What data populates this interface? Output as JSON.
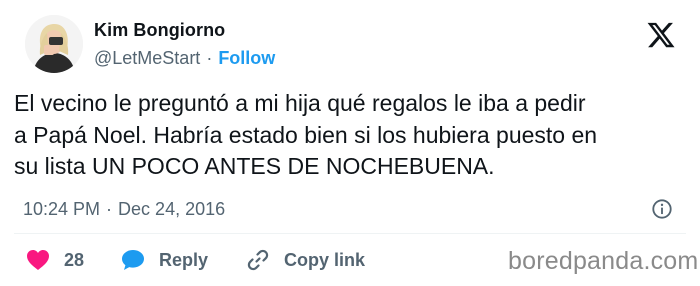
{
  "author": {
    "name": "Kim Bongiorno",
    "handle": "@LetMeStart",
    "separator": "·",
    "follow_label": "Follow"
  },
  "tweet": {
    "lines": [
      "El vecino le preguntó a mi hija qué regalos le iba a pedir",
      "a Papá Noel. Habría estado bien si los hubiera puesto en",
      "su lista UN POCO ANTES DE NOCHEBUENA."
    ],
    "time": "10:24 PM",
    "separator": "·",
    "date": "Dec 24, 2016"
  },
  "actions": {
    "likes": "28",
    "reply_label": "Reply",
    "copy_label": "Copy link"
  },
  "watermark": "boredpanda.com",
  "colors": {
    "text": "#0f1419",
    "muted": "#536471",
    "link_blue": "#1d9bf0",
    "heart": "#f91880",
    "divider": "#eff3f4"
  },
  "icons": [
    "x-logo-icon",
    "info-icon",
    "heart-icon",
    "reply-bubble-icon",
    "link-icon"
  ]
}
